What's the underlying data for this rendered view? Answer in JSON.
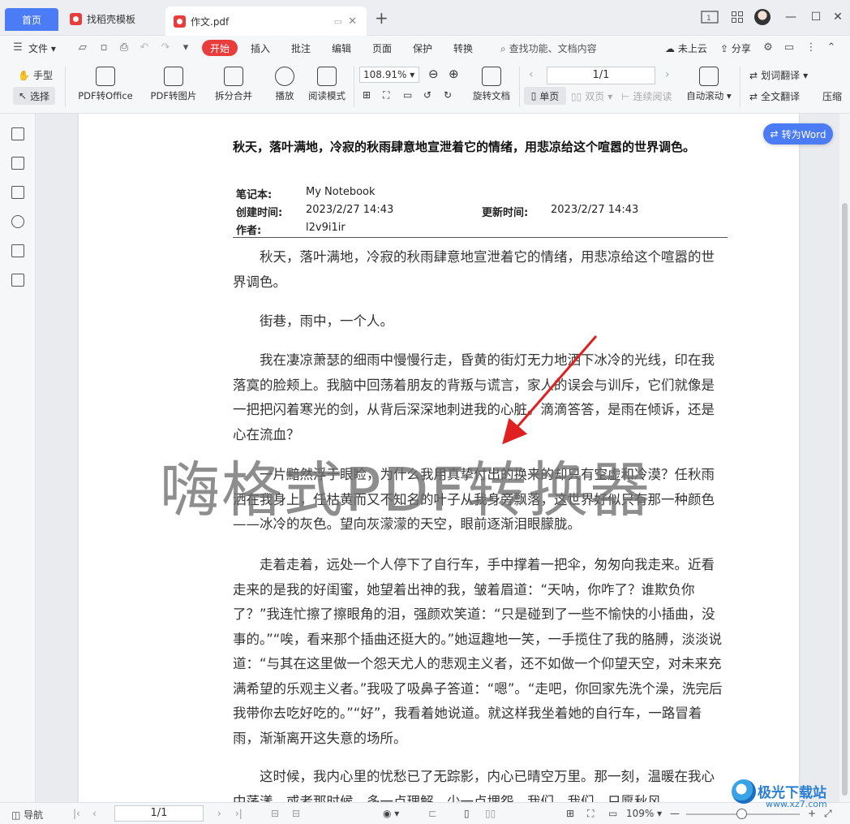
{
  "tabs": {
    "home": "首页",
    "template": "找稻壳模板",
    "document": "作文.pdf"
  },
  "menu": {
    "file": "文件",
    "start": "开始",
    "items": [
      "插入",
      "批注",
      "编辑",
      "页面",
      "保护",
      "转换"
    ],
    "search": "查找功能、文档内容",
    "cloud": "未上云",
    "share": "分享"
  },
  "toolbar": {
    "hand": "手型",
    "select": "选择",
    "pdf_to_office": "PDF转Office",
    "pdf_to_image": "PDF转图片",
    "split_merge": "拆分合并",
    "play": "播放",
    "read_mode": "阅读模式",
    "zoom": "108.91%",
    "rotate_doc": "旋转文档",
    "page_indicator": "1/1",
    "single_page": "单页",
    "double_page": "双页",
    "continuous": "连续阅读",
    "auto_scroll": "自动滚动",
    "word_translate": "划词翻译",
    "full_translate": "全文翻译",
    "compress": "压缩"
  },
  "document": {
    "title": "秋天，落叶满地，冷寂的秋雨肆意地宣泄着它的情绪，用悲凉给这个喧嚣的世界调色。",
    "meta": {
      "notebook_label": "笔记本:",
      "notebook": "My Notebook",
      "created_label": "创建时间:",
      "created": "2023/2/27 14:43",
      "updated_label": "更新时间:",
      "updated": "2023/2/27 14:43",
      "author_label": "作者:",
      "author": "l2v9i1ir"
    },
    "paragraphs": [
      "秋天，落叶满地，冷寂的秋雨肆意地宣泄着它的情绪，用悲凉给这个喧嚣的世界调色。",
      "街巷，雨中，一个人。",
      "我在凄凉萧瑟的细雨中慢慢行走，昏黄的街灯无力地洒下冰冷的光线，印在我落寞的脸颊上。我脑中回荡着朋友的背叛与谎言，家人的误会与训斥，它们就像是一把把闪着寒光的剑，从背后深深地刺进我的心脏。滴滴答答，是雨在倾诉，还是心在流血？",
      "一片黯然浮于眼睑，为什么我用真挚付出的换来的却只有空虚和冷漠？任秋雨洒在我身上，任枯黄而又不知名的叶子从我身旁飘落，这世界好似只有那一种颜色——冰冷的灰色。望向灰濛濛的天空，眼前逐渐泪眼朦胧。",
      "走着走着，远处一个人停下了自行车，手中撑着一把伞，匆匆向我走来。近看走来的是我的好闺蜜，她望着出神的我，皱着眉道：“天呐，你咋了？谁欺负你了？”我连忙擦了擦眼角的泪，强颜欢笑道：“只是碰到了一些不愉快的小插曲，没事的。”“唉，看来那个插曲还挺大的。”她逗趣地一笑，一手揽住了我的胳膊，淡淡说道：“与其在这里做一个怨天尤人的悲观主义者，还不如做一个仰望天空，对未来充满希望的乐观主义者。”我吸了吸鼻子答道：“嗯”。“走吧，你回家先洗个澡，洗完后我带你去吃好吃的。”“好”，我看着她说道。就这样我坐着她的自行车，一路冒着雨，渐渐离开这失意的场所。",
      "这时候，我内心里的忧愁已了无踪影，内心已晴空万里。那一刻，温暖在我心中荡漾，或者那时候，多一点理解，少一点埋怨，我们，我们，只愿秋风"
    ],
    "watermark": "嗨格式PDF转换器"
  },
  "to_word": "转为Word",
  "status": {
    "nav": "导航",
    "page": "1/1",
    "zoom": "109%"
  },
  "brand": {
    "name": "极光下载站",
    "url": "www.xz7.com"
  },
  "colors": {
    "accent": "#4b7bf5",
    "start_red": "#e93d3d",
    "arrow_red": "#e02020"
  }
}
